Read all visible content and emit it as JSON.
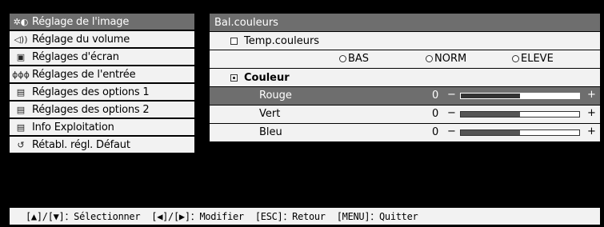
{
  "menu": {
    "items": [
      {
        "label": "Réglage de l'image",
        "icon": "image-adjust-icon",
        "glyph": "✲◐",
        "selected": true
      },
      {
        "label": "Réglage du volume",
        "icon": "speaker-icon",
        "glyph": "◁))",
        "selected": false
      },
      {
        "label": "Réglages d'écran",
        "icon": "screen-icon",
        "glyph": "▣",
        "selected": false
      },
      {
        "label": "Réglages de l'entrée",
        "icon": "input-connectors-icon",
        "glyph": "ɸɸɸ",
        "selected": false
      },
      {
        "label": "Réglages des options 1",
        "icon": "options-icon",
        "glyph": "▤",
        "selected": false
      },
      {
        "label": "Réglages des options 2",
        "icon": "options-icon",
        "glyph": "▤",
        "selected": false
      },
      {
        "label": "Info Exploitation",
        "icon": "info-icon",
        "glyph": "▤",
        "selected": false
      },
      {
        "label": "Rétabl. régl. Défaut",
        "icon": "reset-icon",
        "glyph": "↺",
        "selected": false
      }
    ]
  },
  "panel": {
    "title": "Bal.couleurs",
    "temp_label": "Temp.couleurs",
    "temp_options": [
      "BAS",
      "NORM",
      "ELEVE"
    ],
    "couleur_label": "Couleur",
    "sliders": [
      {
        "label": "Rouge",
        "value": "0",
        "minus": "−",
        "plus": "+",
        "level": 0.5,
        "highlighted": true
      },
      {
        "label": "Vert",
        "value": "0",
        "minus": "−",
        "plus": "+",
        "level": 0.5,
        "highlighted": false
      },
      {
        "label": "Bleu",
        "value": "0",
        "minus": "−",
        "plus": "+",
        "level": 0.5,
        "highlighted": false
      }
    ]
  },
  "footer": {
    "hints": [
      "[▲]/[▼]：Sélectionner",
      "[◀]/[▶]：Modifier",
      "[ESC]：Retour",
      "[MENU]：Quitter"
    ]
  }
}
